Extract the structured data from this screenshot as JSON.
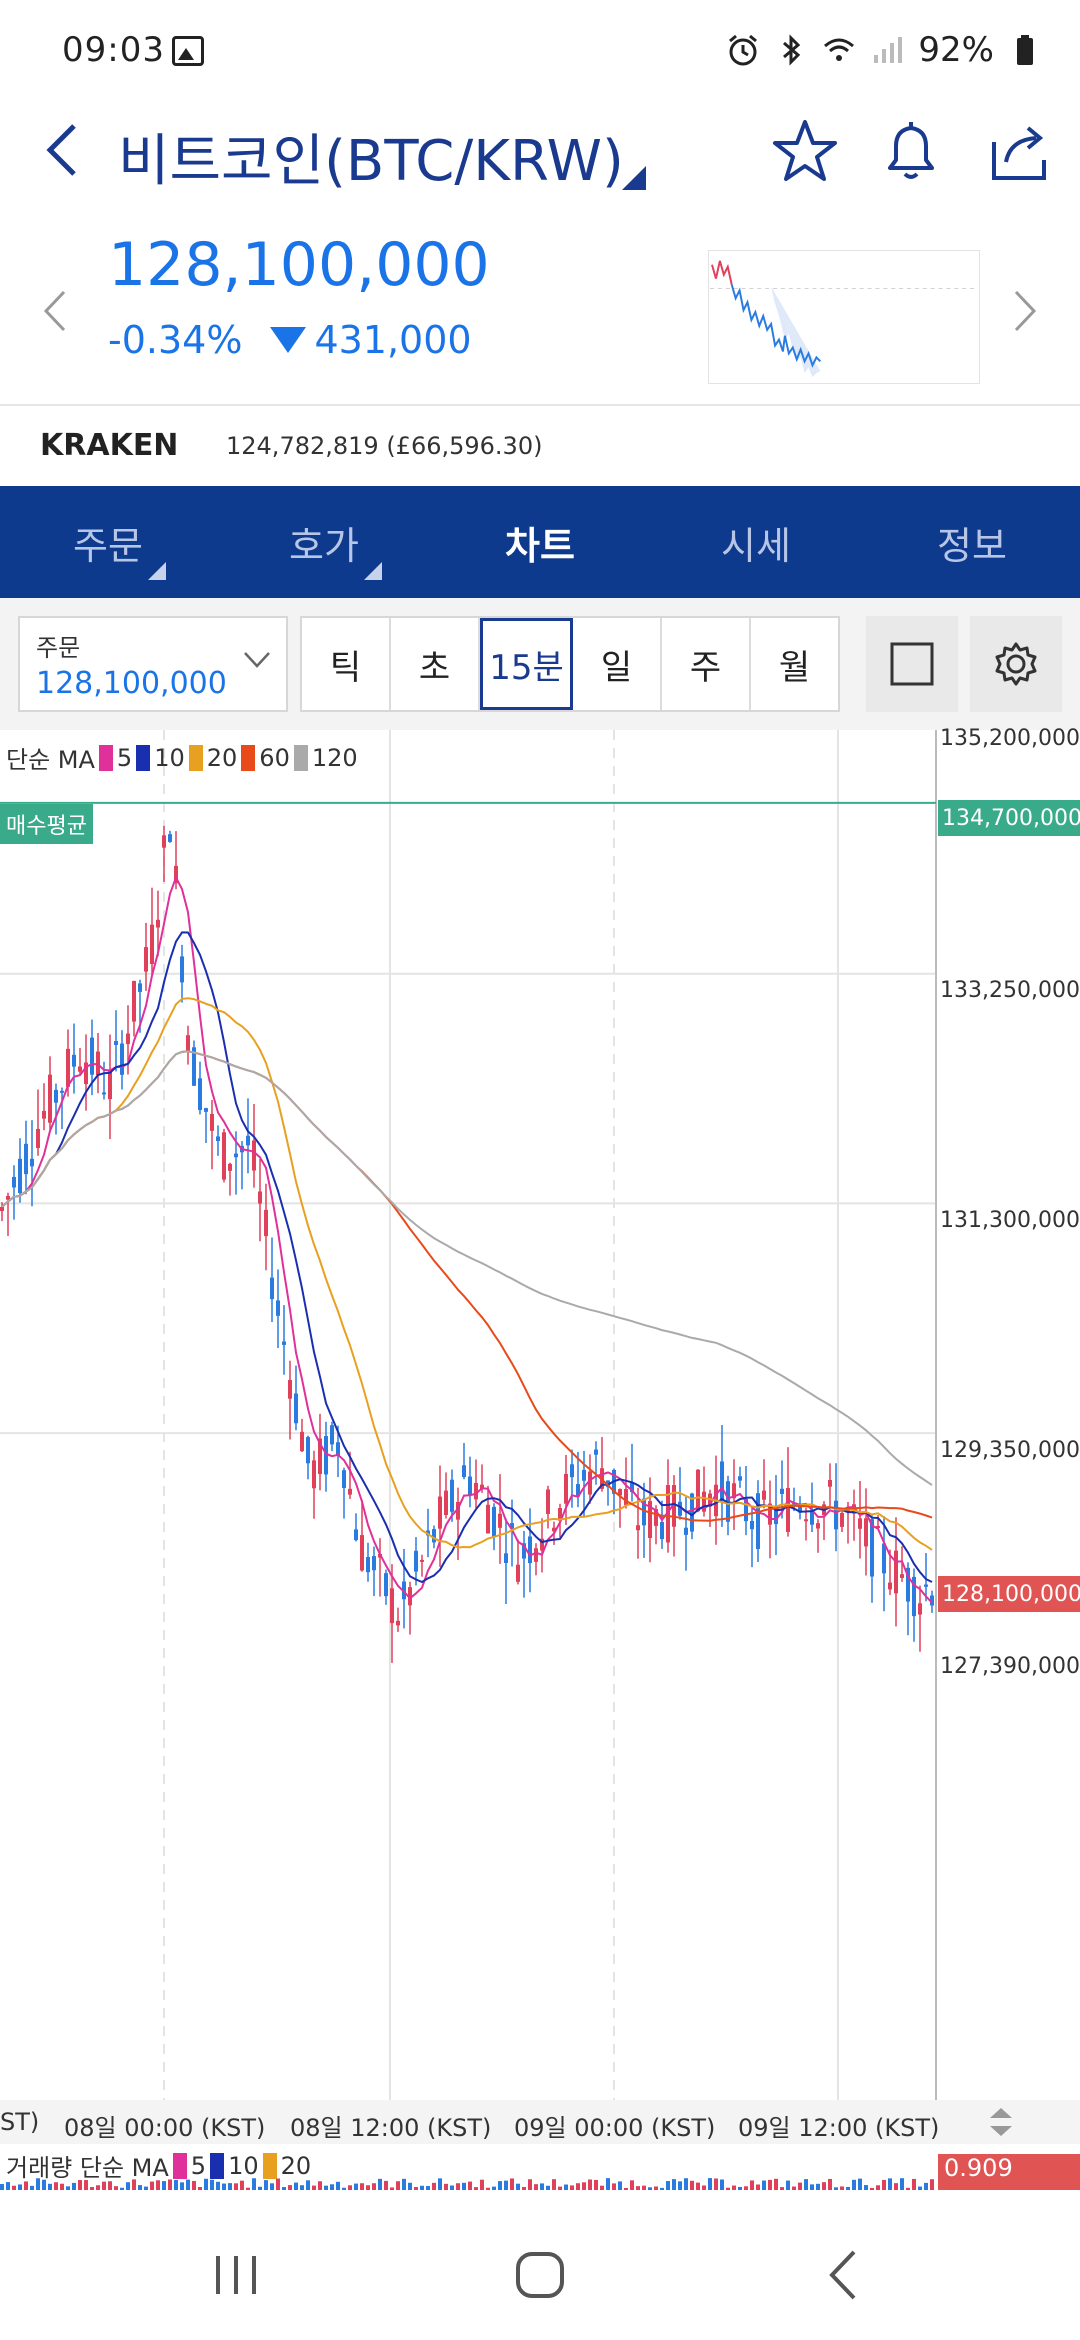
{
  "status_bar": {
    "time": "09:03",
    "battery": "92%"
  },
  "header": {
    "title": "비트코인(BTC/KRW)"
  },
  "price": {
    "current": "128,100,000",
    "change_pct": "-0.34%",
    "change_abs": "431,000"
  },
  "exchange": {
    "name": "KRAKEN",
    "price": "124,782,819 (£66,596.30)"
  },
  "tabs": [
    {
      "label": "주문"
    },
    {
      "label": "호가"
    },
    {
      "label": "차트"
    },
    {
      "label": "시세"
    },
    {
      "label": "정보"
    }
  ],
  "toolbar": {
    "order_label": "주문",
    "order_value": "128,100,000",
    "periods": [
      "틱",
      "초",
      "15분",
      "일",
      "주",
      "월"
    ],
    "active_period": "15분"
  },
  "chart_data": {
    "type": "candlestick",
    "legend": {
      "prefix": "단순 MA",
      "periods": [
        "5",
        "10",
        "20",
        "60",
        "120"
      ]
    },
    "avg_buy_label": "매수평균",
    "avg_buy_price": "134,700,000",
    "current_price_tag": "128,100,000",
    "y_ticks": [
      "135,200,000",
      "133,250,000",
      "131,300,000",
      "129,350,000",
      "127,390,000"
    ],
    "y_range": [
      127390000,
      135200000
    ],
    "x_ticks": [
      "ST)",
      "08일 00:00 (KST)",
      "08일 12:00 (KST)",
      "09일 00:00 (KST)",
      "09일 12:00 (KST)"
    ],
    "ma_colors": {
      "5": "#e0309a",
      "10": "#1a2fb0",
      "20": "#e8a020",
      "60": "#e84a1a",
      "120": "#aaaaaa"
    },
    "volume_legend": {
      "prefix": "거래량 단순 MA",
      "periods": [
        "5",
        "10",
        "20"
      ]
    },
    "volume_tag": "0.909"
  },
  "colors": {
    "brand": "#0d3a8c",
    "up": "#e0405a",
    "down": "#2a7be0",
    "avg": "#3aab8a"
  }
}
